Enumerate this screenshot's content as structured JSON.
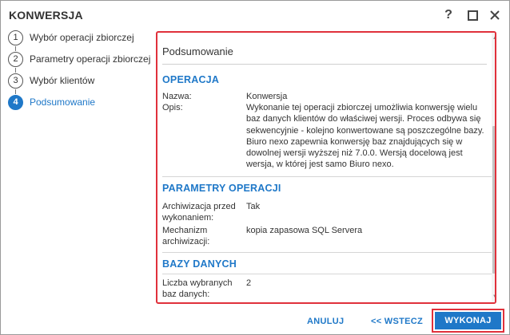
{
  "window": {
    "title": "KONWERSJA",
    "controls": {
      "help": "?",
      "maximize": "maximize-icon",
      "close": "close-icon"
    }
  },
  "steps": [
    {
      "number": "1",
      "label": "Wybór operacji zbiorczej",
      "active": false
    },
    {
      "number": "2",
      "label": "Parametry operacji zbiorczej",
      "active": false
    },
    {
      "number": "3",
      "label": "Wybór klientów",
      "active": false
    },
    {
      "number": "4",
      "label": "Podsumowanie",
      "active": true
    }
  ],
  "summary": {
    "header": "Podsumowanie",
    "sections": [
      {
        "title": "OPERACJA",
        "rows": [
          {
            "key": "Nazwa:",
            "value": "Konwersja"
          },
          {
            "key": "Opis:",
            "value": "Wykonanie tej operacji zbiorczej umożliwia konwersję wielu baz danych klientów do właściwej wersji. Proces odbywa się sekwencyjnie - kolejno konwertowane są poszczególne bazy. Biuro nexo zapewnia konwersję baz znajdujących się w dowolnej wersji wyższej niż 7.0.0. Wersją docelową jest wersja, w której jest samo Biuro nexo."
          }
        ]
      },
      {
        "title": "PARAMETRY OPERACJI",
        "rows": [
          {
            "key": "Archiwizacja przed wykonaniem:",
            "value": "Tak"
          },
          {
            "key": "Mechanizm archiwizacji:",
            "value": "kopia zapasowa SQL Servera"
          }
        ]
      },
      {
        "title": "BAZY DANYCH",
        "rows": [
          {
            "key": "Liczba wybranych baz danych:",
            "value": "2"
          }
        ]
      }
    ]
  },
  "footer": {
    "cancel": "ANULUJ",
    "back": "<< WSTECZ",
    "execute": "WYKONAJ"
  },
  "colors": {
    "accent": "#1f78c8",
    "highlight": "#e0313b"
  }
}
